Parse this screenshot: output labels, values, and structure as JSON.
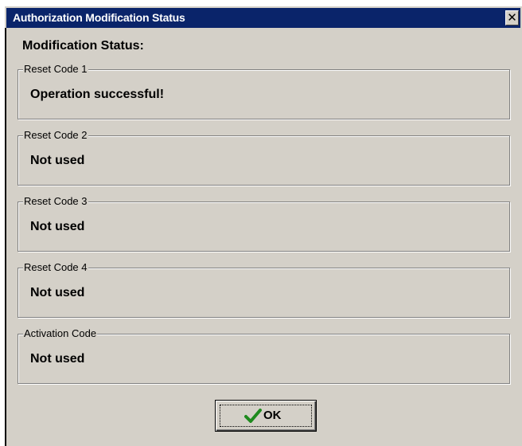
{
  "window": {
    "title": "Authorization Modification Status",
    "close_glyph": "✕"
  },
  "heading": "Modification Status:",
  "groups": [
    {
      "label": "Reset Code 1",
      "value": "Operation successful!"
    },
    {
      "label": "Reset Code 2",
      "value": "Not used"
    },
    {
      "label": "Reset Code 3",
      "value": "Not used"
    },
    {
      "label": "Reset Code 4",
      "value": "Not used"
    },
    {
      "label": "Activation Code",
      "value": "Not used"
    }
  ],
  "ok_button": {
    "label": "OK",
    "icon": "checkmark-icon"
  },
  "colors": {
    "titlebar": "#0a246a",
    "dialog_bg": "#d4d0c8",
    "check_green": "#1e8a1e"
  }
}
